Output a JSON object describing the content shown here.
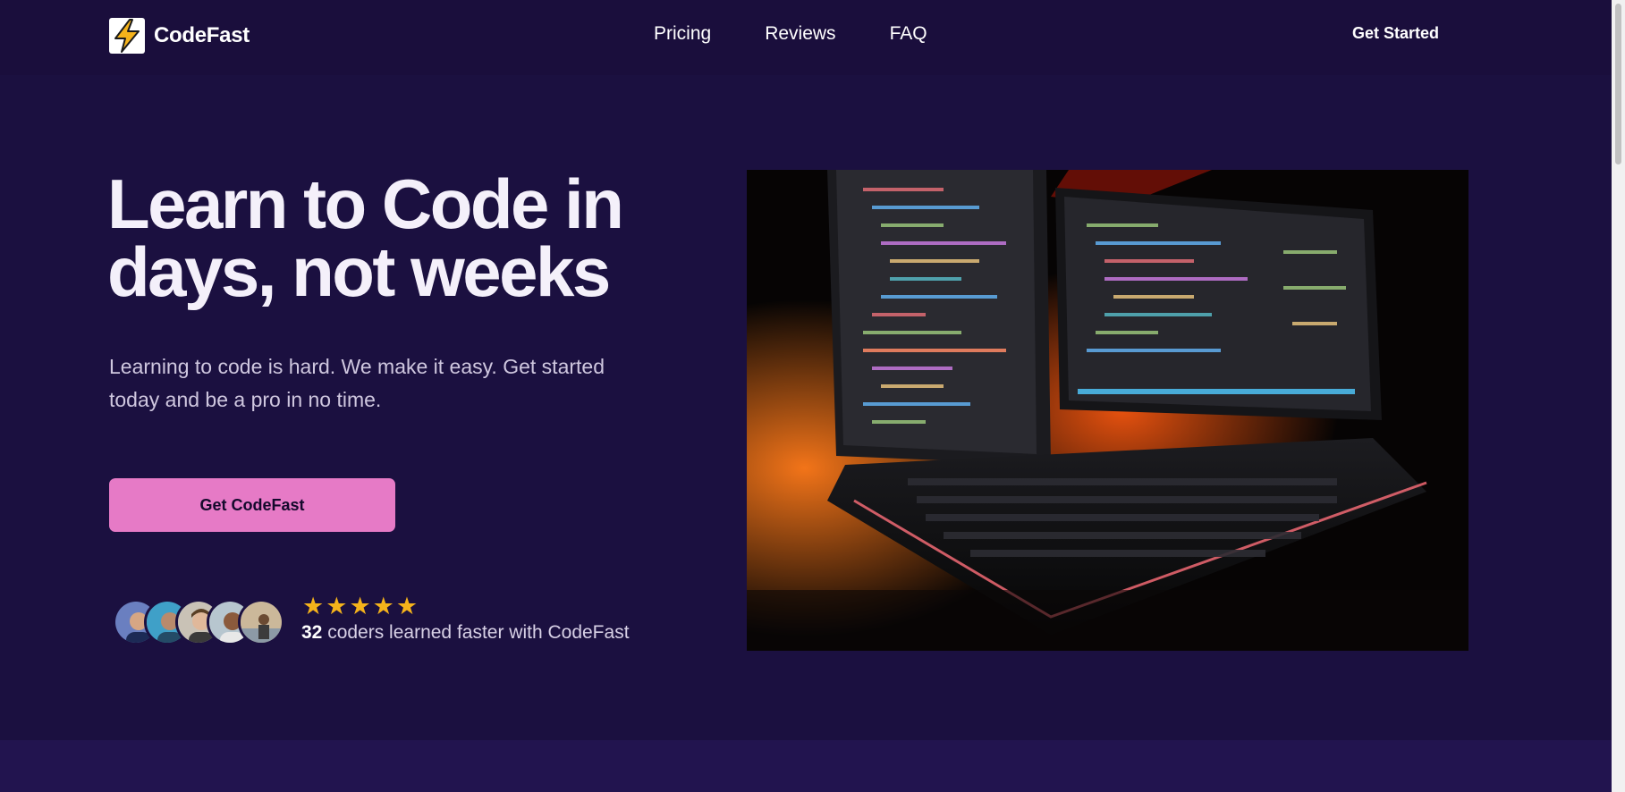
{
  "brand": {
    "name": "CodeFast",
    "logo_icon": "lightning-bolt-icon",
    "logo_color": "#f5b31b"
  },
  "nav": {
    "items": [
      {
        "label": "Pricing"
      },
      {
        "label": "Reviews"
      },
      {
        "label": "FAQ"
      }
    ],
    "cta_label": "Get Started"
  },
  "hero": {
    "title": "Learn to Code in days, not weeks",
    "subtitle": "Learning to code is hard. We make it easy. Get started today and be a pro in no time.",
    "button_label": "Get CodeFast",
    "button_color": "#e67ac6",
    "image_icon": "monitors-keyboard-photo"
  },
  "social_proof": {
    "rating_stars": 5,
    "star_glyph": "★",
    "star_color": "#f5b31b",
    "count": "32",
    "text": " coders learned faster with CodeFast",
    "avatars": [
      "avatar-1",
      "avatar-2",
      "avatar-3",
      "avatar-4",
      "avatar-5"
    ]
  },
  "colors": {
    "background": "#1b1040",
    "header": "#1a0e3c",
    "accent": "#e67ac6"
  }
}
